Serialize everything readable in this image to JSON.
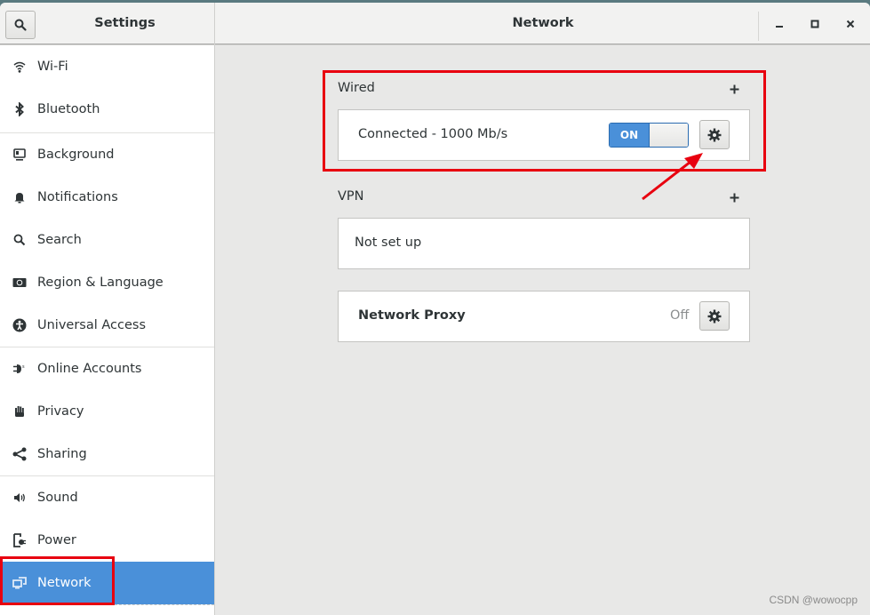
{
  "window": {
    "sidebar_title": "Settings",
    "panel_title": "Network",
    "controls": [
      "minimize",
      "maximize",
      "close"
    ]
  },
  "sidebar": {
    "items": [
      {
        "label": "Wi-Fi",
        "icon": "wifi-icon"
      },
      {
        "label": "Bluetooth",
        "icon": "bluetooth-icon"
      },
      {
        "label": "Background",
        "icon": "background-icon"
      },
      {
        "label": "Notifications",
        "icon": "bell-icon"
      },
      {
        "label": "Search",
        "icon": "search-icon"
      },
      {
        "label": "Region & Language",
        "icon": "region-icon"
      },
      {
        "label": "Universal Access",
        "icon": "accessibility-icon"
      },
      {
        "label": "Online Accounts",
        "icon": "online-accounts-icon"
      },
      {
        "label": "Privacy",
        "icon": "hand-icon"
      },
      {
        "label": "Sharing",
        "icon": "share-icon"
      },
      {
        "label": "Sound",
        "icon": "speaker-icon"
      },
      {
        "label": "Power",
        "icon": "power-icon"
      },
      {
        "label": "Network",
        "icon": "network-icon",
        "active": true
      }
    ]
  },
  "main": {
    "wired": {
      "section_label": "Wired",
      "add_label": "+",
      "status": "Connected - 1000 Mb/s",
      "toggle_label": "ON",
      "toggle_state": true
    },
    "vpn": {
      "section_label": "VPN",
      "add_label": "+",
      "status": "Not set up"
    },
    "proxy": {
      "label": "Network Proxy",
      "status": "Off"
    }
  },
  "colors": {
    "accent": "#4a90d9",
    "annotation": "#e8000f"
  },
  "watermark": "CSDN @wowocpp"
}
